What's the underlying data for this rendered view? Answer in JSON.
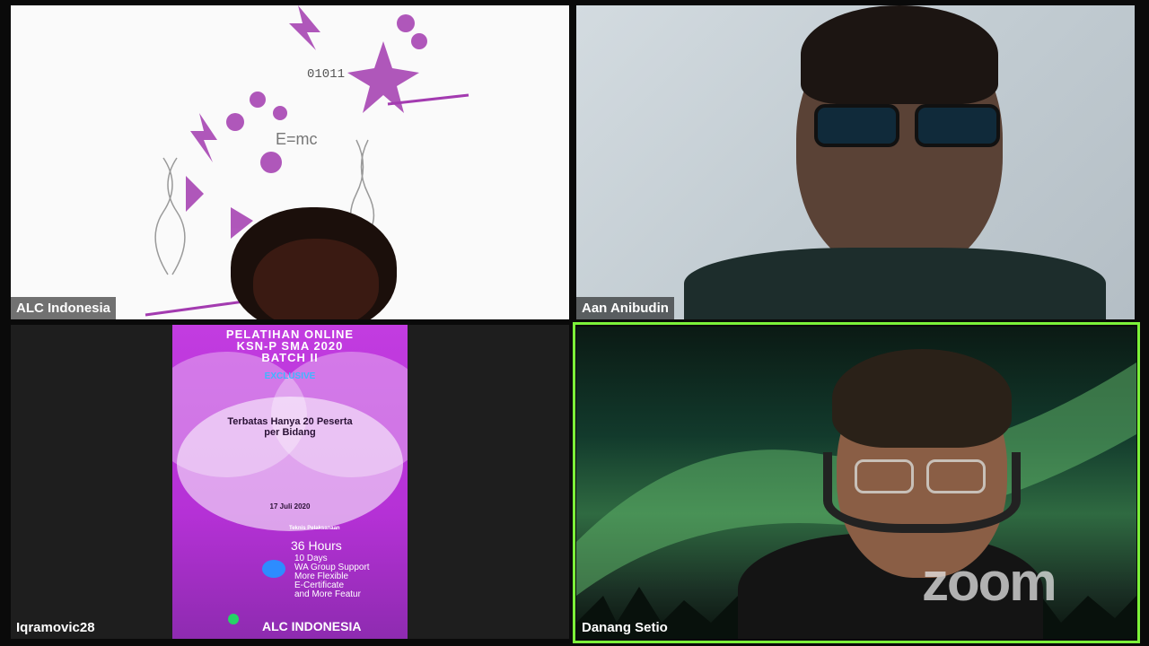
{
  "participants": [
    {
      "name": "ALC Indonesia"
    },
    {
      "name": "Aan Anibudin"
    },
    {
      "name": "Iqramovic28"
    },
    {
      "name": "Danang Setio"
    }
  ],
  "poster": {
    "title_line1": "PELATIHAN ONLINE",
    "title_line2": "KSN-P SMA 2020",
    "title_line3": "BATCH II",
    "exclusive": "EXCLUSIVE",
    "limit_line1": "Terbatas Hanya 20 Peserta",
    "limit_line2": "per Bidang",
    "date": "17 Juli 2020",
    "teknis": "Teknis Pelaksanaan",
    "hours": "36 Hours",
    "days": "10 Days",
    "wa": "WA Group Support",
    "flexible": "More Flexible",
    "certificate": "E-Certificate",
    "more": "and More Featur",
    "brand": "ALC INDONESIA"
  },
  "watermark": "zoom",
  "colors": {
    "active_speaker_border": "#7cf23a"
  }
}
